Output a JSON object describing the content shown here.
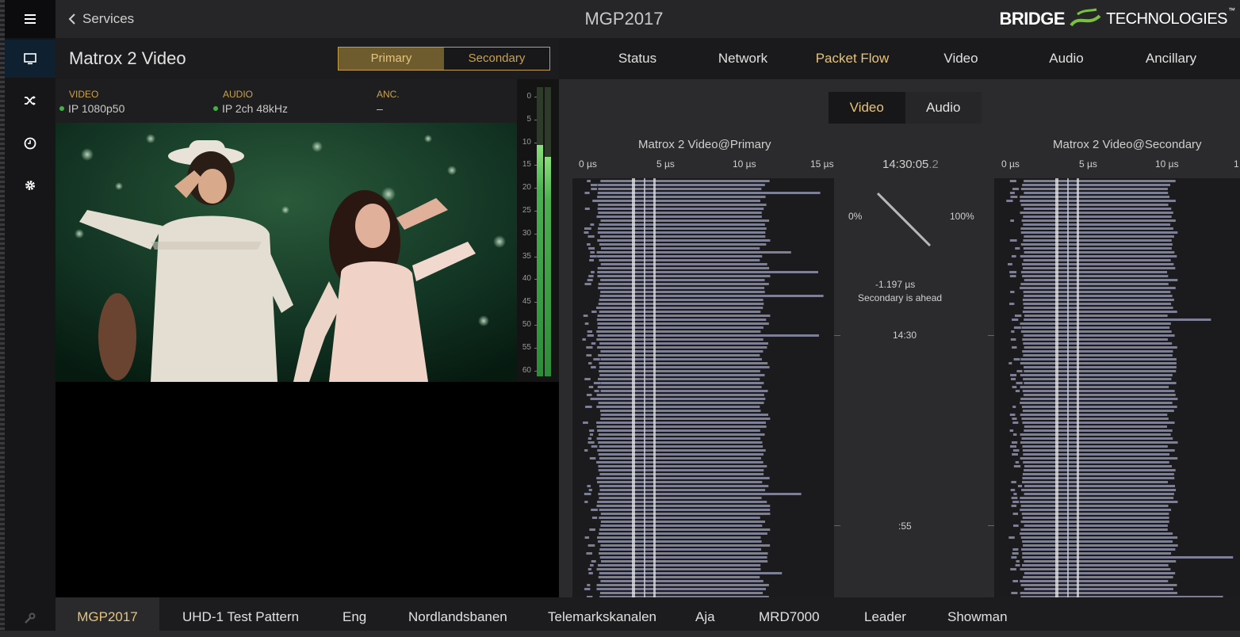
{
  "header": {
    "back_label": "Services",
    "title": "MGP2017",
    "logo_bold": "BRIDGE",
    "logo_text": "TECHNOLOGIES",
    "logo_tm": "™"
  },
  "rail": {
    "icons": [
      "menu-icon",
      "monitor-icon",
      "shuffle-icon",
      "clock-icon",
      "gear-icon",
      "wrench-icon"
    ]
  },
  "service": {
    "title": "Matrox 2 Video",
    "primary_label": "Primary",
    "secondary_label": "Secondary"
  },
  "nav_tabs": [
    "Status",
    "Network",
    "Packet Flow",
    "Video",
    "Audio",
    "Ancillary"
  ],
  "active_nav": "Packet Flow",
  "signal_info": [
    {
      "label": "VIDEO",
      "value": "IP 1080p50",
      "status_color": "#3fb34a"
    },
    {
      "label": "AUDIO",
      "value": "IP 2ch 48kHz",
      "status_color": "#3fb34a"
    },
    {
      "label": "ANC.",
      "value": "–"
    }
  ],
  "meter": {
    "ticks": [
      "0",
      "5",
      "10",
      "15",
      "20",
      "25",
      "30",
      "35",
      "40",
      "45",
      "50",
      "55",
      "60"
    ],
    "levels": [
      0.8,
      0.76
    ]
  },
  "packet_flow": {
    "video_tab": "Video",
    "audio_tab": "Audio",
    "primary_title": "Matrox 2 Video@Primary",
    "secondary_title": "Matrox 2 Video@Secondary",
    "primary_axis": [
      "0 µs",
      "5 µs",
      "10 µs",
      "15 µs"
    ],
    "secondary_axis": [
      "0 µs",
      "5 µs",
      "10 µs",
      "1"
    ],
    "time_main": "14:30:05",
    "time_sub": ".2",
    "pct_min": "0%",
    "pct_max": "100%",
    "offset_value": "-1.197 µs",
    "offset_text": "Secondary is ahead",
    "time_mark_1": "14:30",
    "time_mark_2": ":55"
  },
  "bottom_tabs": [
    "MGP2017",
    "UHD-1 Test Pattern",
    "Eng",
    "Nordlandsbanen",
    "Telemarkskanalen",
    "Aja",
    "MRD7000",
    "Leader",
    "Showman"
  ],
  "active_bottom": "MGP2017",
  "colors": {
    "accent_gold": "#e5c37a",
    "status_green": "#3fb34a",
    "packet_bar": "#7d7f96"
  }
}
